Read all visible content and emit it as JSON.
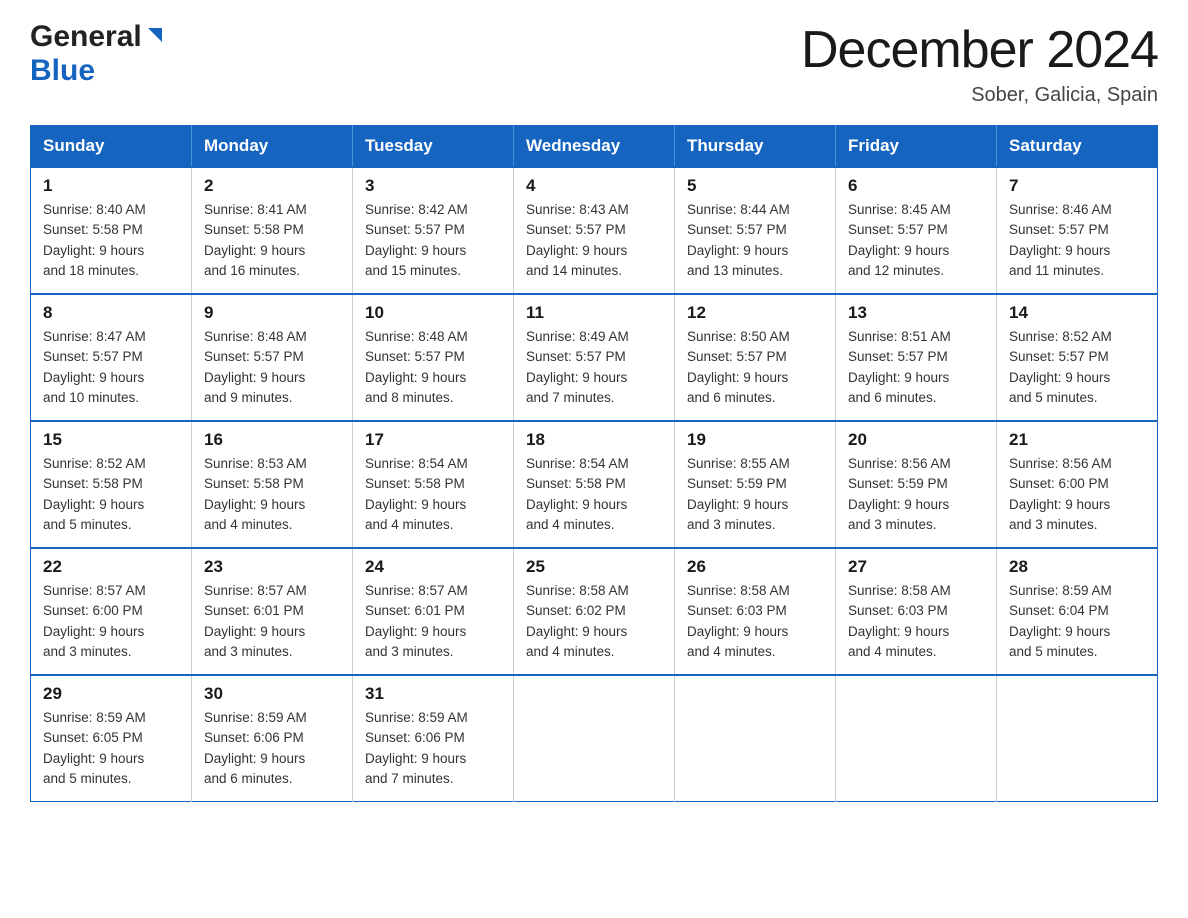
{
  "header": {
    "logo_general": "General",
    "logo_blue": "Blue",
    "month": "December 2024",
    "location": "Sober, Galicia, Spain"
  },
  "days_of_week": [
    "Sunday",
    "Monday",
    "Tuesday",
    "Wednesday",
    "Thursday",
    "Friday",
    "Saturday"
  ],
  "weeks": [
    [
      {
        "day": "1",
        "sunrise": "8:40 AM",
        "sunset": "5:58 PM",
        "daylight": "9 hours and 18 minutes."
      },
      {
        "day": "2",
        "sunrise": "8:41 AM",
        "sunset": "5:58 PM",
        "daylight": "9 hours and 16 minutes."
      },
      {
        "day": "3",
        "sunrise": "8:42 AM",
        "sunset": "5:57 PM",
        "daylight": "9 hours and 15 minutes."
      },
      {
        "day": "4",
        "sunrise": "8:43 AM",
        "sunset": "5:57 PM",
        "daylight": "9 hours and 14 minutes."
      },
      {
        "day": "5",
        "sunrise": "8:44 AM",
        "sunset": "5:57 PM",
        "daylight": "9 hours and 13 minutes."
      },
      {
        "day": "6",
        "sunrise": "8:45 AM",
        "sunset": "5:57 PM",
        "daylight": "9 hours and 12 minutes."
      },
      {
        "day": "7",
        "sunrise": "8:46 AM",
        "sunset": "5:57 PM",
        "daylight": "9 hours and 11 minutes."
      }
    ],
    [
      {
        "day": "8",
        "sunrise": "8:47 AM",
        "sunset": "5:57 PM",
        "daylight": "9 hours and 10 minutes."
      },
      {
        "day": "9",
        "sunrise": "8:48 AM",
        "sunset": "5:57 PM",
        "daylight": "9 hours and 9 minutes."
      },
      {
        "day": "10",
        "sunrise": "8:48 AM",
        "sunset": "5:57 PM",
        "daylight": "9 hours and 8 minutes."
      },
      {
        "day": "11",
        "sunrise": "8:49 AM",
        "sunset": "5:57 PM",
        "daylight": "9 hours and 7 minutes."
      },
      {
        "day": "12",
        "sunrise": "8:50 AM",
        "sunset": "5:57 PM",
        "daylight": "9 hours and 6 minutes."
      },
      {
        "day": "13",
        "sunrise": "8:51 AM",
        "sunset": "5:57 PM",
        "daylight": "9 hours and 6 minutes."
      },
      {
        "day": "14",
        "sunrise": "8:52 AM",
        "sunset": "5:57 PM",
        "daylight": "9 hours and 5 minutes."
      }
    ],
    [
      {
        "day": "15",
        "sunrise": "8:52 AM",
        "sunset": "5:58 PM",
        "daylight": "9 hours and 5 minutes."
      },
      {
        "day": "16",
        "sunrise": "8:53 AM",
        "sunset": "5:58 PM",
        "daylight": "9 hours and 4 minutes."
      },
      {
        "day": "17",
        "sunrise": "8:54 AM",
        "sunset": "5:58 PM",
        "daylight": "9 hours and 4 minutes."
      },
      {
        "day": "18",
        "sunrise": "8:54 AM",
        "sunset": "5:58 PM",
        "daylight": "9 hours and 4 minutes."
      },
      {
        "day": "19",
        "sunrise": "8:55 AM",
        "sunset": "5:59 PM",
        "daylight": "9 hours and 3 minutes."
      },
      {
        "day": "20",
        "sunrise": "8:56 AM",
        "sunset": "5:59 PM",
        "daylight": "9 hours and 3 minutes."
      },
      {
        "day": "21",
        "sunrise": "8:56 AM",
        "sunset": "6:00 PM",
        "daylight": "9 hours and 3 minutes."
      }
    ],
    [
      {
        "day": "22",
        "sunrise": "8:57 AM",
        "sunset": "6:00 PM",
        "daylight": "9 hours and 3 minutes."
      },
      {
        "day": "23",
        "sunrise": "8:57 AM",
        "sunset": "6:01 PM",
        "daylight": "9 hours and 3 minutes."
      },
      {
        "day": "24",
        "sunrise": "8:57 AM",
        "sunset": "6:01 PM",
        "daylight": "9 hours and 3 minutes."
      },
      {
        "day": "25",
        "sunrise": "8:58 AM",
        "sunset": "6:02 PM",
        "daylight": "9 hours and 4 minutes."
      },
      {
        "day": "26",
        "sunrise": "8:58 AM",
        "sunset": "6:03 PM",
        "daylight": "9 hours and 4 minutes."
      },
      {
        "day": "27",
        "sunrise": "8:58 AM",
        "sunset": "6:03 PM",
        "daylight": "9 hours and 4 minutes."
      },
      {
        "day": "28",
        "sunrise": "8:59 AM",
        "sunset": "6:04 PM",
        "daylight": "9 hours and 5 minutes."
      }
    ],
    [
      {
        "day": "29",
        "sunrise": "8:59 AM",
        "sunset": "6:05 PM",
        "daylight": "9 hours and 5 minutes."
      },
      {
        "day": "30",
        "sunrise": "8:59 AM",
        "sunset": "6:06 PM",
        "daylight": "9 hours and 6 minutes."
      },
      {
        "day": "31",
        "sunrise": "8:59 AM",
        "sunset": "6:06 PM",
        "daylight": "9 hours and 7 minutes."
      },
      null,
      null,
      null,
      null
    ]
  ],
  "labels": {
    "sunrise": "Sunrise:",
    "sunset": "Sunset:",
    "daylight": "Daylight:"
  }
}
